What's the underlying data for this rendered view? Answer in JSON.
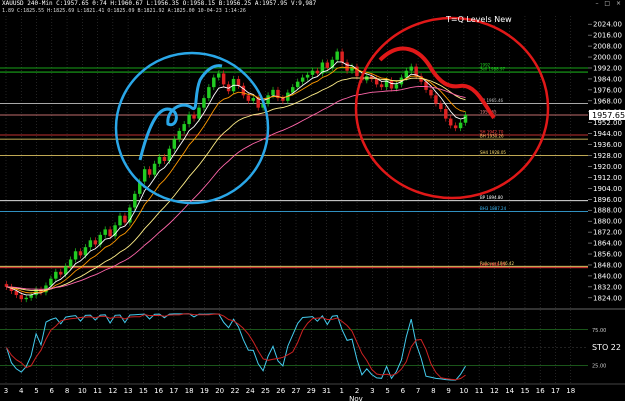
{
  "header": {
    "line1": "XAUUSD 240-Min  C:1957.65  0:74  H:1960.67  L:1956.35  O:1958.15  B:1956.25  A:1957.95  V:9,987",
    "line2": "1.89  C:1825.55  H:1825.69  L:1821.41  O:1825.09  B:1821.92  A:1825.00 10-04-23 1:14:26"
  },
  "title": "T=Q Levels New",
  "window_icons": "– □ ×",
  "indicator_label": "STO 22",
  "chart_data": {
    "type": "candlestick",
    "symbol": "XAUUSD",
    "timeframe": "240-Min",
    "last_price": "1957.65",
    "ylim": [
      1818,
      2030
    ],
    "y_ticks": [
      "2024.00",
      "2016.00",
      "2008.00",
      "2000.00",
      "1992.00",
      "1984.00",
      "1976.00",
      "1968.00",
      "1960.00",
      "1952.00",
      "1944.00",
      "1936.00",
      "1928.00",
      "1920.00",
      "1912.00",
      "1904.00",
      "1896.00",
      "1888.00",
      "1880.00",
      "1872.00",
      "1864.00",
      "1856.00",
      "1848.00",
      "1840.00",
      "1832.00",
      "1824.00"
    ],
    "x_ticks": [
      "3",
      "4",
      "5",
      "6",
      "8",
      "10",
      "11",
      "12",
      "13",
      "15",
      "16",
      "17",
      "18",
      "19",
      "20",
      "22",
      "24",
      "25",
      "26",
      "27",
      "29",
      "31",
      "1",
      "2",
      "3",
      "5",
      "6",
      "7",
      "8",
      "9",
      "10",
      "11",
      "12",
      "14",
      "15",
      "16",
      "17",
      "18"
    ],
    "x_month_label": "Nov",
    "ohlc_closes": [
      1832,
      1829,
      1826,
      1823,
      1824,
      1826,
      1830,
      1828,
      1833,
      1838,
      1843,
      1841,
      1847,
      1852,
      1858,
      1855,
      1861,
      1866,
      1863,
      1870,
      1874,
      1869,
      1877,
      1884,
      1879,
      1890,
      1900,
      1909,
      1918,
      1914,
      1922,
      1927,
      1924,
      1933,
      1940,
      1946,
      1951,
      1958,
      1955,
      1963,
      1970,
      1978,
      1985,
      1988,
      1980,
      1975,
      1984,
      1979,
      1972,
      1968,
      1970,
      1963,
      1966,
      1972,
      1976,
      1970,
      1968,
      1974,
      1978,
      1982,
      1985,
      1987,
      1990,
      1988,
      1996,
      1992,
      1998,
      2004,
      1996,
      1990,
      1993,
      1986,
      1983,
      1986,
      1984,
      1980,
      1978,
      1983,
      1977,
      1980,
      1985,
      1990,
      1993,
      1986,
      1982,
      1976,
      1972,
      1966,
      1962,
      1955,
      1950,
      1948,
      1952,
      1957.65
    ],
    "levels": [
      {
        "label": "1992",
        "value": 1992,
        "color": "#21d421"
      },
      {
        "label": "Sell 1988.97",
        "value": 1989,
        "color": "#21d421"
      },
      {
        "label": "YR 1965.46",
        "value": 1966,
        "color": "#c0c0c0"
      },
      {
        "label": "1957.65",
        "value": 1957.65,
        "color": "#ff9090"
      },
      {
        "label": "BH 1930.26",
        "value": 1940,
        "color": "#ffe070"
      },
      {
        "label": "SH 1942.70",
        "value": 1943,
        "color": "#ff4040"
      },
      {
        "label": "SH4 1928.05",
        "value": 1928,
        "color": "#ffe070"
      },
      {
        "label": "BP 1894.80",
        "value": 1895,
        "color": "#ffffff"
      },
      {
        "label": "BH3 1887.24",
        "value": 1887,
        "color": "#40c0ff"
      },
      {
        "label": "Rollover 1846.42",
        "value": 1847,
        "color": "#ffe070"
      },
      {
        "label": "Low 1846.25",
        "value": 1846,
        "color": "#ff4040"
      }
    ],
    "overbought": "75.00",
    "oversold": "25.00"
  }
}
